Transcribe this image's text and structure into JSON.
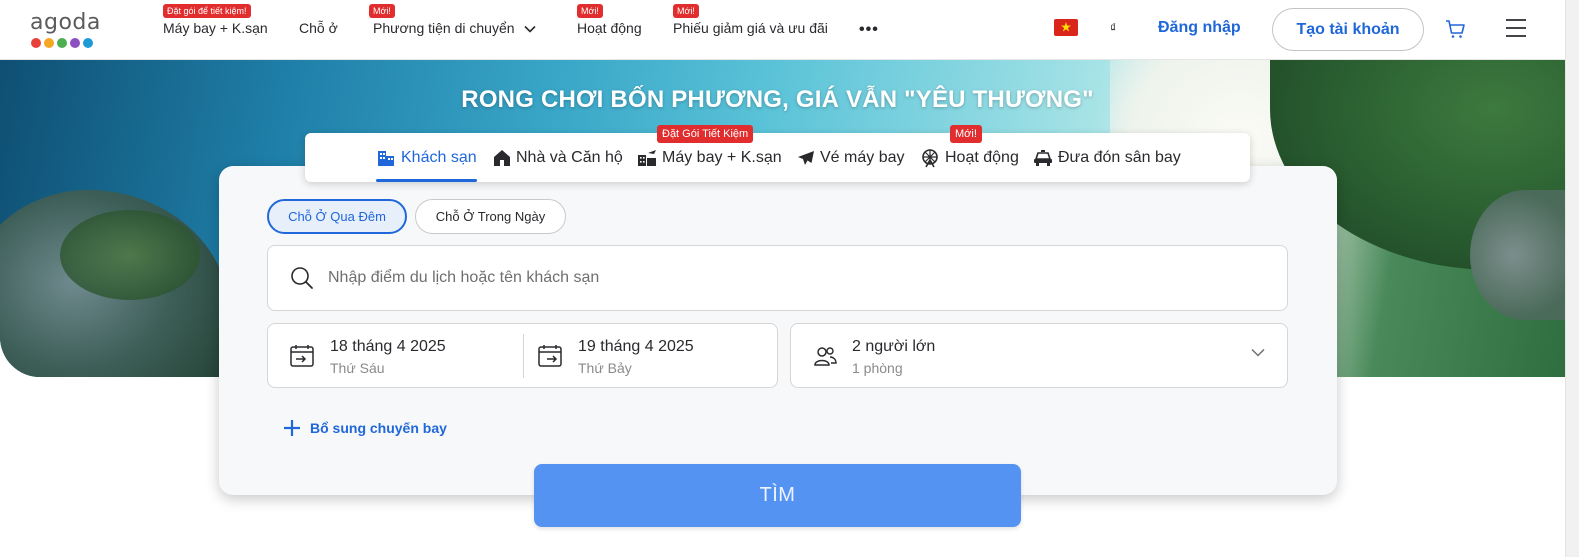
{
  "brand": {
    "logo_text": "agoda",
    "logo_dot_colors": [
      "#e8413b",
      "#f5a623",
      "#4caf50",
      "#8e4fc1",
      "#1e9bd7"
    ]
  },
  "nav": {
    "items": [
      {
        "label": "Máy bay + K.sạn",
        "badge": "Đặt gói để tiết kiệm!"
      },
      {
        "label": "Chỗ ở",
        "badge": ""
      },
      {
        "label": "Phương tiện di chuyển",
        "badge": "Mới!"
      },
      {
        "label": "Hoạt động",
        "badge": "Mới!"
      },
      {
        "label": "Phiếu giảm giá và ưu đãi",
        "badge": "Mới!"
      }
    ],
    "more_icon": "more-horizontal-icon",
    "currency": "₫",
    "login": "Đăng nhập",
    "signup": "Tạo tài khoản",
    "flag_icon": "vietnam-flag-icon",
    "cart_icon": "cart-icon",
    "menu_icon": "hamburger-menu-icon"
  },
  "hero": {
    "headline": "RONG CHƠI BỐN PHƯƠNG, GIÁ VẪN \"YÊU THƯƠNG\""
  },
  "tabs": [
    {
      "label": "Khách sạn",
      "icon": "hotel-icon",
      "active": true,
      "badge": ""
    },
    {
      "label": "Nhà và Căn hộ",
      "icon": "house-icon",
      "active": false,
      "badge": ""
    },
    {
      "label": "Máy bay + K.sạn",
      "icon": "flight-hotel-icon",
      "active": false,
      "badge": "Đặt Gói Tiết Kiệm"
    },
    {
      "label": "Vé máy bay",
      "icon": "airplane-icon",
      "active": false,
      "badge": ""
    },
    {
      "label": "Hoạt động",
      "icon": "ferris-wheel-icon",
      "active": false,
      "badge": "Mới!"
    },
    {
      "label": "Đưa đón sân bay",
      "icon": "car-icon",
      "active": false,
      "badge": ""
    }
  ],
  "stay_type": {
    "overnight": "Chỗ Ở Qua Đêm",
    "day_use": "Chỗ Ở Trong Ngày",
    "selected": "overnight"
  },
  "search": {
    "placeholder": "Nhập điểm du lịch hoặc tên khách sạn",
    "value": ""
  },
  "dates": {
    "checkin": {
      "date": "18 tháng 4 2025",
      "weekday": "Thứ Sáu"
    },
    "checkout": {
      "date": "19 tháng 4 2025",
      "weekday": "Thứ Bảy"
    }
  },
  "guests": {
    "adults": "2 người lớn",
    "rooms": "1 phòng"
  },
  "add_flight": "Bổ sung chuyến bay",
  "search_button": "TÌM",
  "colors": {
    "accent": "#2067da",
    "badge": "#e12d2d",
    "search_button": "#5593f3"
  }
}
